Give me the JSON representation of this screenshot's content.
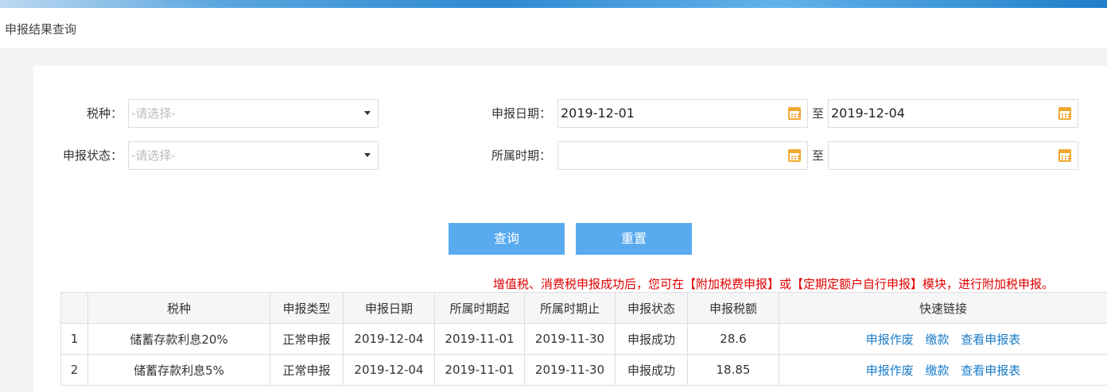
{
  "page_title": "申报结果查询",
  "form": {
    "tax_type_label": "税种：",
    "tax_type_placeholder": "-请选择-",
    "status_label": "申报状态：",
    "status_placeholder": "-请选择-",
    "declare_date_label": "申报日期：",
    "declare_date_from": "2019-12-01",
    "declare_date_to": "2019-12-04",
    "to_label": "至",
    "period_label": "所属时期：",
    "period_from": "",
    "period_to": ""
  },
  "buttons": {
    "query": "查询",
    "reset": "重置"
  },
  "notice": "增值税、消费税申报成功后，您可在【附加税费申报】或【定期定额户自行申报】模块，进行附加税申报。",
  "table": {
    "headers": [
      "",
      "税种",
      "申报类型",
      "申报日期",
      "所属时期起",
      "所属时期止",
      "申报状态",
      "申报税额",
      "快速链接"
    ],
    "rows": [
      {
        "index": "1",
        "tax": "储蓄存款利息20%",
        "type": "正常申报",
        "date": "2019-12-04",
        "start": "2019-11-01",
        "end": "2019-11-30",
        "status": "申报成功",
        "amount": "28.6"
      },
      {
        "index": "2",
        "tax": "储蓄存款利息5%",
        "type": "正常申报",
        "date": "2019-12-04",
        "start": "2019-11-01",
        "end": "2019-11-30",
        "status": "申报成功",
        "amount": "18.85"
      }
    ],
    "links": {
      "void": "申报作废",
      "pay": "缴款",
      "view": "查看申报表"
    }
  },
  "colors": {
    "accent": "#5aaaf0",
    "notice": "#e00000",
    "link": "#1a7cc9",
    "calendar": "#f0a830"
  },
  "icons": [
    "calendar-icon",
    "chevron-down-icon"
  ]
}
